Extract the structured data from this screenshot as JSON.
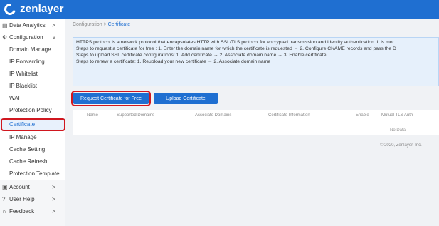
{
  "brand": {
    "name": "zenlayer",
    "color": "#1f6fd1"
  },
  "sidebar": {
    "items": [
      {
        "label": "Data Analytics",
        "icon": "grid-icon",
        "arrow": ">"
      },
      {
        "label": "Configuration",
        "icon": "gear-icon",
        "arrow": "∨"
      }
    ],
    "config_children": [
      "Domain Manage",
      "IP Forwarding",
      "IP Whitelist",
      "IP Blacklist",
      "WAF",
      "Protection Policy",
      "Certificate",
      "IP Manage",
      "Cache Setting",
      "Cache Refresh",
      "Protection Template"
    ],
    "bottom_items": [
      {
        "label": "Account",
        "icon": "account-icon",
        "arrow": ">"
      },
      {
        "label": "User Help",
        "icon": "help-icon",
        "arrow": ">"
      },
      {
        "label": "Feedback",
        "icon": "headset-icon",
        "arrow": ">"
      }
    ],
    "active": "Certificate"
  },
  "breadcrumb": {
    "parent": "Configuration",
    "sep": ">",
    "current": "Certificate"
  },
  "notice": {
    "lines": [
      "HTTPS protocol is a network protocol that encapsulates HTTP with SSL/TLS protocol for encrypted transmission and identity authentication. It is mor",
      "Steps to request a certificate for free : 1. Enter the domain name for which the certificate is requested → 2. Configure CNAME records and pass the D",
      "Steps to upload SSL certificate configurations: 1. Add certificate → 2. Associate domain name → 3. Enable certificate",
      "Steps to renew a certificate: 1. Reupload your new certificate → 2. Associate domain name"
    ]
  },
  "buttons": {
    "request": "Request Certificate for Free",
    "upload": "Upload Certificate"
  },
  "table": {
    "columns": [
      "Name",
      "Supported Domains",
      "Associate Domains",
      "Certificate Information",
      "Enable",
      "Mutual TLS Auth"
    ],
    "empty": "No Data"
  },
  "footer": "© 2020, Zenlayer, Inc."
}
